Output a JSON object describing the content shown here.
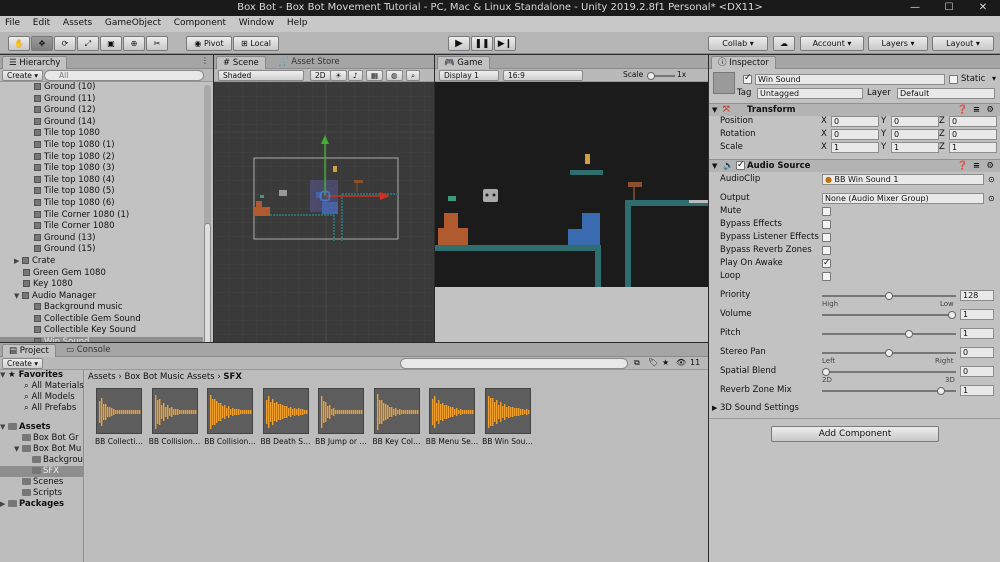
{
  "window": {
    "title": "Box Bot - Box Bot Movement Tutorial - PC, Mac & Linux Standalone - Unity 2019.2.8f1 Personal* <DX11>",
    "minimize": "—",
    "maximize": "☐",
    "close": "✕"
  },
  "menu": [
    "File",
    "Edit",
    "Assets",
    "GameObject",
    "Component",
    "Window",
    "Help"
  ],
  "toolbar": {
    "pivot": "Pivot",
    "local": "Local",
    "collab": "Collab ▾",
    "account": "Account ▾",
    "layers": "Layers ▾",
    "layout": "Layout ▾"
  },
  "hierarchy": {
    "tab": "Hierarchy",
    "create": "Create ▾",
    "search_placeholder": "All",
    "items": [
      {
        "label": "Ground (10)",
        "indent": 2
      },
      {
        "label": "Ground (11)",
        "indent": 2
      },
      {
        "label": "Ground (12)",
        "indent": 2
      },
      {
        "label": "Ground (14)",
        "indent": 2
      },
      {
        "label": "Tile top 1080",
        "indent": 2
      },
      {
        "label": "Tile top 1080 (1)",
        "indent": 2
      },
      {
        "label": "Tile top 1080 (2)",
        "indent": 2
      },
      {
        "label": "Tile top 1080 (3)",
        "indent": 2
      },
      {
        "label": "Tile top 1080 (4)",
        "indent": 2
      },
      {
        "label": "Tile top 1080 (5)",
        "indent": 2
      },
      {
        "label": "Tile top 1080 (6)",
        "indent": 2
      },
      {
        "label": "Tile Corner 1080 (1)",
        "indent": 2
      },
      {
        "label": "Tile Corner 1080",
        "indent": 2
      },
      {
        "label": "Ground (13)",
        "indent": 2
      },
      {
        "label": "Ground (15)",
        "indent": 2
      },
      {
        "label": "Crate",
        "indent": 1,
        "arrow": "▶"
      },
      {
        "label": "Green Gem 1080",
        "indent": 1
      },
      {
        "label": "Key 1080",
        "indent": 1
      },
      {
        "label": "Audio Manager",
        "indent": 1,
        "arrow": "▼"
      },
      {
        "label": "Background music",
        "indent": 2
      },
      {
        "label": "Collectible Gem Sound",
        "indent": 2
      },
      {
        "label": "Collectible Key Sound",
        "indent": 2
      },
      {
        "label": "Win Sound",
        "indent": 2,
        "selected": true
      }
    ]
  },
  "scene": {
    "tab": "Scene",
    "asset_store_tab": "Asset Store",
    "shading": "Shaded",
    "mode_2d": "2D"
  },
  "game": {
    "tab": "Game",
    "display": "Display 1",
    "aspect": "16:9",
    "scale_label": "Scale",
    "scale_value": "1x"
  },
  "inspector": {
    "tab": "Inspector",
    "object_name": "Win Sound",
    "static_label": "Static",
    "tag_label": "Tag",
    "tag_value": "Untagged",
    "layer_label": "Layer",
    "layer_value": "Default",
    "transform": {
      "title": "Transform",
      "position_label": "Position",
      "rotation_label": "Rotation",
      "scale_label": "Scale",
      "position": [
        "0",
        "0",
        "0"
      ],
      "rotation": [
        "0",
        "0",
        "0"
      ],
      "scale": [
        "1",
        "1",
        "1"
      ]
    },
    "audio_source": {
      "title": "Audio Source",
      "audioclip_label": "AudioClip",
      "audioclip_value": "BB Win Sound 1",
      "output_label": "Output",
      "output_value": "None (Audio Mixer Group)",
      "mute": "Mute",
      "bypass_effects": "Bypass Effects",
      "bypass_listener": "Bypass Listener Effects",
      "bypass_reverb": "Bypass Reverb Zones",
      "play_on_awake": "Play On Awake",
      "play_on_awake_checked": true,
      "loop": "Loop",
      "priority_label": "Priority",
      "priority_value": "128",
      "priority_level": 0.5,
      "priority_high": "High",
      "priority_low": "Low",
      "volume_label": "Volume",
      "volume_value": "1",
      "volume_level": 1.0,
      "pitch_label": "Pitch",
      "pitch_value": "1",
      "pitch_level": 0.66,
      "stereo_label": "Stereo Pan",
      "stereo_value": "0",
      "stereo_level": 0.5,
      "stereo_left": "Left",
      "stereo_right": "Right",
      "spatial_label": "Spatial Blend",
      "spatial_value": "0",
      "spatial_level": 0.0,
      "spatial_2d": "2D",
      "spatial_3d": "3D",
      "reverb_label": "Reverb Zone Mix",
      "reverb_value": "1",
      "reverb_level": 0.91,
      "settings_3d": "3D Sound Settings"
    },
    "add_component": "Add Component"
  },
  "project": {
    "tab": "Project",
    "console_tab": "Console",
    "create": "Create ▾",
    "hidden_count": "11",
    "favorites": {
      "label": "Favorites",
      "items": [
        "All Materials",
        "All Models",
        "All Prefabs"
      ]
    },
    "assets_label": "Assets",
    "asset_tree": [
      {
        "label": "Box Bot Gr",
        "indent": 1
      },
      {
        "label": "Box Bot Mu",
        "indent": 1,
        "arrow": "▼"
      },
      {
        "label": "Backgrou",
        "indent": 2
      },
      {
        "label": "SFX",
        "indent": 2,
        "selected": true
      },
      {
        "label": "Scenes",
        "indent": 1
      },
      {
        "label": "Scripts",
        "indent": 1
      }
    ],
    "packages_label": "Packages",
    "breadcrumb": [
      "Assets",
      "Box Bot Music Assets",
      "SFX"
    ],
    "files": [
      "BB Collecti…",
      "BB Collision…",
      "BB Collision…",
      "BB Death S…",
      "BB Jump or …",
      "BB Key Col…",
      "BB Menu Se…",
      "BB Win Sou…"
    ]
  },
  "colors": {
    "waveform": "#f0a030",
    "gizmo_red": "#d03020",
    "gizmo_green": "#40b030",
    "tile_teal": "#2e6e6e"
  }
}
